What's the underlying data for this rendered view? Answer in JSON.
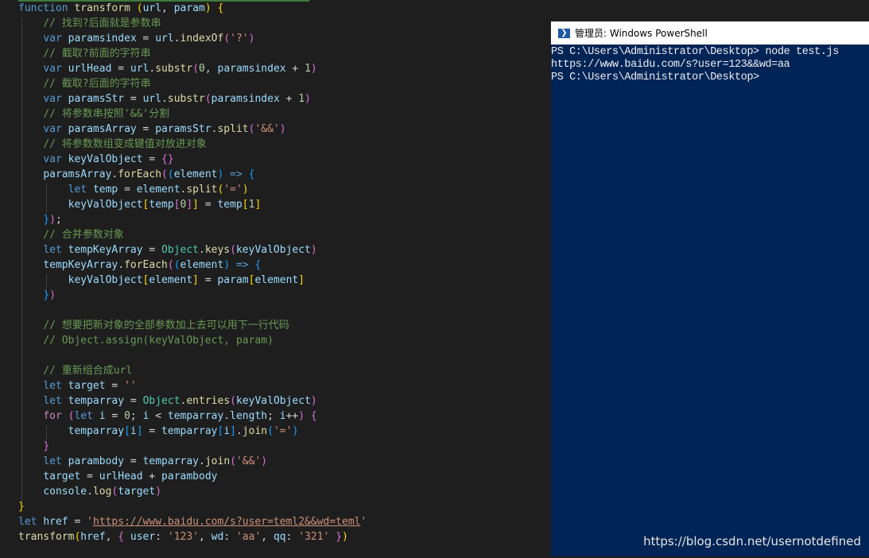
{
  "editor": {
    "lines": [
      [
        [
          "kw",
          "function "
        ],
        [
          "fn",
          "transform "
        ],
        [
          "b1",
          "("
        ],
        [
          "vr",
          "url"
        ],
        [
          "op",
          ", "
        ],
        [
          "vr",
          "param"
        ],
        [
          "b1",
          ")"
        ],
        [
          "op",
          " "
        ],
        [
          "b1",
          "{"
        ]
      ],
      [
        [
          "op",
          "    "
        ],
        [
          "cm",
          "// 找到?后面就是参数串"
        ]
      ],
      [
        [
          "op",
          "    "
        ],
        [
          "kw",
          "var "
        ],
        [
          "vr",
          "paramsindex"
        ],
        [
          "op",
          " = "
        ],
        [
          "vr",
          "url"
        ],
        [
          "op",
          "."
        ],
        [
          "fn",
          "indexOf"
        ],
        [
          "b2",
          "("
        ],
        [
          "st",
          "'?'"
        ],
        [
          "b2",
          ")"
        ]
      ],
      [
        [
          "op",
          "    "
        ],
        [
          "cm",
          "// 截取?前面的字符串"
        ]
      ],
      [
        [
          "op",
          "    "
        ],
        [
          "kw",
          "var "
        ],
        [
          "vr",
          "urlHead"
        ],
        [
          "op",
          " = "
        ],
        [
          "vr",
          "url"
        ],
        [
          "op",
          "."
        ],
        [
          "fn",
          "substr"
        ],
        [
          "b2",
          "("
        ],
        [
          "nm",
          "0"
        ],
        [
          "op",
          ", "
        ],
        [
          "vr",
          "paramsindex"
        ],
        [
          "op",
          " + "
        ],
        [
          "nm",
          "1"
        ],
        [
          "b2",
          ")"
        ]
      ],
      [
        [
          "op",
          "    "
        ],
        [
          "cm",
          "// 截取?后面的字符串"
        ]
      ],
      [
        [
          "op",
          "    "
        ],
        [
          "kw",
          "var "
        ],
        [
          "vr",
          "paramsStr"
        ],
        [
          "op",
          " = "
        ],
        [
          "vr",
          "url"
        ],
        [
          "op",
          "."
        ],
        [
          "fn",
          "substr"
        ],
        [
          "b2",
          "("
        ],
        [
          "vr",
          "paramsindex"
        ],
        [
          "op",
          " + "
        ],
        [
          "nm",
          "1"
        ],
        [
          "b2",
          ")"
        ]
      ],
      [
        [
          "op",
          "    "
        ],
        [
          "cm",
          "// 将参数串按照'&&'分割"
        ]
      ],
      [
        [
          "op",
          "    "
        ],
        [
          "kw",
          "var "
        ],
        [
          "vr",
          "paramsArray"
        ],
        [
          "op",
          " = "
        ],
        [
          "vr",
          "paramsStr"
        ],
        [
          "op",
          "."
        ],
        [
          "fn",
          "split"
        ],
        [
          "b2",
          "("
        ],
        [
          "st",
          "'&&'"
        ],
        [
          "b2",
          ")"
        ]
      ],
      [
        [
          "op",
          "    "
        ],
        [
          "cm",
          "// 将参数数组变成键值对放进对象"
        ]
      ],
      [
        [
          "op",
          "    "
        ],
        [
          "kw",
          "var "
        ],
        [
          "vr",
          "keyValObject"
        ],
        [
          "op",
          " = "
        ],
        [
          "b2",
          "{}"
        ]
      ],
      [
        [
          "op",
          "    "
        ],
        [
          "vr",
          "paramsArray"
        ],
        [
          "op",
          "."
        ],
        [
          "fn",
          "forEach"
        ],
        [
          "b2",
          "("
        ],
        [
          "b3",
          "("
        ],
        [
          "vr",
          "element"
        ],
        [
          "b3",
          ")"
        ],
        [
          "op",
          " "
        ],
        [
          "kw",
          "=>"
        ],
        [
          "op",
          " "
        ],
        [
          "b3",
          "{"
        ]
      ],
      [
        [
          "op",
          "        "
        ],
        [
          "kw",
          "let "
        ],
        [
          "vr",
          "temp"
        ],
        [
          "op",
          " = "
        ],
        [
          "vr",
          "element"
        ],
        [
          "op",
          "."
        ],
        [
          "fn",
          "split"
        ],
        [
          "b1",
          "("
        ],
        [
          "st",
          "'='"
        ],
        [
          "b1",
          ")"
        ]
      ],
      [
        [
          "op",
          "        "
        ],
        [
          "vr",
          "keyValObject"
        ],
        [
          "b1",
          "["
        ],
        [
          "vr",
          "temp"
        ],
        [
          "b2",
          "["
        ],
        [
          "nm",
          "0"
        ],
        [
          "b2",
          "]"
        ],
        [
          "b1",
          "]"
        ],
        [
          "op",
          " = "
        ],
        [
          "vr",
          "temp"
        ],
        [
          "b1",
          "["
        ],
        [
          "nm",
          "1"
        ],
        [
          "b1",
          "]"
        ]
      ],
      [
        [
          "op",
          "    "
        ],
        [
          "b3",
          "}"
        ],
        [
          "b2",
          ")"
        ],
        [
          "op",
          ";"
        ]
      ],
      [
        [
          "op",
          "    "
        ],
        [
          "cm",
          "// 合并参数对象"
        ]
      ],
      [
        [
          "op",
          "    "
        ],
        [
          "kw",
          "let "
        ],
        [
          "vr",
          "tempKeyArray"
        ],
        [
          "op",
          " = "
        ],
        [
          "cl",
          "Object"
        ],
        [
          "op",
          "."
        ],
        [
          "fn",
          "keys"
        ],
        [
          "b2",
          "("
        ],
        [
          "vr",
          "keyValObject"
        ],
        [
          "b2",
          ")"
        ]
      ],
      [
        [
          "op",
          "    "
        ],
        [
          "vr",
          "tempKeyArray"
        ],
        [
          "op",
          "."
        ],
        [
          "fn",
          "forEach"
        ],
        [
          "b2",
          "("
        ],
        [
          "b3",
          "("
        ],
        [
          "vr",
          "element"
        ],
        [
          "b3",
          ")"
        ],
        [
          "op",
          " "
        ],
        [
          "kw",
          "=>"
        ],
        [
          "op",
          " "
        ],
        [
          "b3",
          "{"
        ]
      ],
      [
        [
          "op",
          "        "
        ],
        [
          "vr",
          "keyValObject"
        ],
        [
          "b1",
          "["
        ],
        [
          "vr",
          "element"
        ],
        [
          "b1",
          "]"
        ],
        [
          "op",
          " = "
        ],
        [
          "vr",
          "param"
        ],
        [
          "b1",
          "["
        ],
        [
          "vr",
          "element"
        ],
        [
          "b1",
          "]"
        ]
      ],
      [
        [
          "op",
          "    "
        ],
        [
          "b3",
          "}"
        ],
        [
          "b2",
          ")"
        ]
      ],
      [],
      [
        [
          "op",
          "    "
        ],
        [
          "cm",
          "// 想要把新对象的全部参数加上去可以用下一行代码"
        ]
      ],
      [
        [
          "op",
          "    "
        ],
        [
          "cm",
          "// Object.assign(keyValObject, param)"
        ]
      ],
      [],
      [
        [
          "op",
          "    "
        ],
        [
          "cm",
          "// 重新组合成url"
        ]
      ],
      [
        [
          "op",
          "    "
        ],
        [
          "kw",
          "let "
        ],
        [
          "vr",
          "target"
        ],
        [
          "op",
          " = "
        ],
        [
          "st",
          "''"
        ]
      ],
      [
        [
          "op",
          "    "
        ],
        [
          "kw",
          "let "
        ],
        [
          "vr",
          "temparray"
        ],
        [
          "op",
          " = "
        ],
        [
          "cl",
          "Object"
        ],
        [
          "op",
          "."
        ],
        [
          "fn",
          "entries"
        ],
        [
          "b2",
          "("
        ],
        [
          "vr",
          "keyValObject"
        ],
        [
          "b2",
          ")"
        ]
      ],
      [
        [
          "op",
          "    "
        ],
        [
          "kw2",
          "for "
        ],
        [
          "b2",
          "("
        ],
        [
          "kw",
          "let "
        ],
        [
          "vr",
          "i"
        ],
        [
          "op",
          " = "
        ],
        [
          "nm",
          "0"
        ],
        [
          "op",
          "; "
        ],
        [
          "vr",
          "i"
        ],
        [
          "op",
          " < "
        ],
        [
          "vr",
          "temparray"
        ],
        [
          "op",
          "."
        ],
        [
          "vr",
          "length"
        ],
        [
          "op",
          "; "
        ],
        [
          "vr",
          "i"
        ],
        [
          "op",
          "++"
        ],
        [
          "b2",
          ")"
        ],
        [
          "op",
          " "
        ],
        [
          "b2",
          "{"
        ]
      ],
      [
        [
          "op",
          "        "
        ],
        [
          "vr",
          "temparray"
        ],
        [
          "b3",
          "["
        ],
        [
          "vr",
          "i"
        ],
        [
          "b3",
          "]"
        ],
        [
          "op",
          " = "
        ],
        [
          "vr",
          "temparray"
        ],
        [
          "b3",
          "["
        ],
        [
          "vr",
          "i"
        ],
        [
          "b3",
          "]"
        ],
        [
          "op",
          "."
        ],
        [
          "fn",
          "join"
        ],
        [
          "b3",
          "("
        ],
        [
          "st",
          "'='"
        ],
        [
          "b3",
          ")"
        ]
      ],
      [
        [
          "op",
          "    "
        ],
        [
          "b2",
          "}"
        ]
      ],
      [
        [
          "op",
          "    "
        ],
        [
          "kw",
          "let "
        ],
        [
          "vr",
          "parambody"
        ],
        [
          "op",
          " = "
        ],
        [
          "vr",
          "temparray"
        ],
        [
          "op",
          "."
        ],
        [
          "fn",
          "join"
        ],
        [
          "b2",
          "("
        ],
        [
          "st",
          "'&&'"
        ],
        [
          "b2",
          ")"
        ]
      ],
      [
        [
          "op",
          "    "
        ],
        [
          "vr",
          "target"
        ],
        [
          "op",
          " = "
        ],
        [
          "vr",
          "urlHead"
        ],
        [
          "op",
          " + "
        ],
        [
          "vr",
          "parambody"
        ]
      ],
      [
        [
          "op",
          "    "
        ],
        [
          "vr",
          "console"
        ],
        [
          "op",
          "."
        ],
        [
          "fn",
          "log"
        ],
        [
          "b2",
          "("
        ],
        [
          "vr",
          "target"
        ],
        [
          "b2",
          ")"
        ]
      ],
      [
        [
          "b1",
          "}"
        ]
      ],
      [
        [
          "kw",
          "let "
        ],
        [
          "vr",
          "href"
        ],
        [
          "op",
          " = "
        ],
        [
          "st",
          "'"
        ],
        [
          "url",
          "https://www.baidu.com/s?user=teml2&&wd=teml"
        ],
        [
          "st",
          "'"
        ]
      ],
      [
        [
          "fn",
          "transform"
        ],
        [
          "b1",
          "("
        ],
        [
          "vr",
          "href"
        ],
        [
          "op",
          ", "
        ],
        [
          "b2",
          "{ "
        ],
        [
          "vr",
          "user"
        ],
        [
          "op",
          ": "
        ],
        [
          "st",
          "'123'"
        ],
        [
          "op",
          ", "
        ],
        [
          "vr",
          "wd"
        ],
        [
          "op",
          ": "
        ],
        [
          "st",
          "'aa'"
        ],
        [
          "op",
          ", "
        ],
        [
          "vr",
          "qq"
        ],
        [
          "op",
          ": "
        ],
        [
          "st",
          "'321'"
        ],
        [
          "b2",
          " }"
        ],
        [
          "b1",
          ")"
        ]
      ]
    ]
  },
  "powershell": {
    "title": "管理员: Windows PowerShell",
    "icon_glyph": "❯",
    "lines": [
      "PS C:\\Users\\Administrator\\Desktop> node test.js",
      "https://www.baidu.com/s?user=123&&wd=aa",
      "PS C:\\Users\\Administrator\\Desktop>"
    ]
  },
  "watermark": "https://blog.csdn.net/usernotdefined",
  "colors": {
    "editor_background": "#1e1e1e",
    "powershell_background": "#012456",
    "powershell_text": "#eeedf0"
  }
}
